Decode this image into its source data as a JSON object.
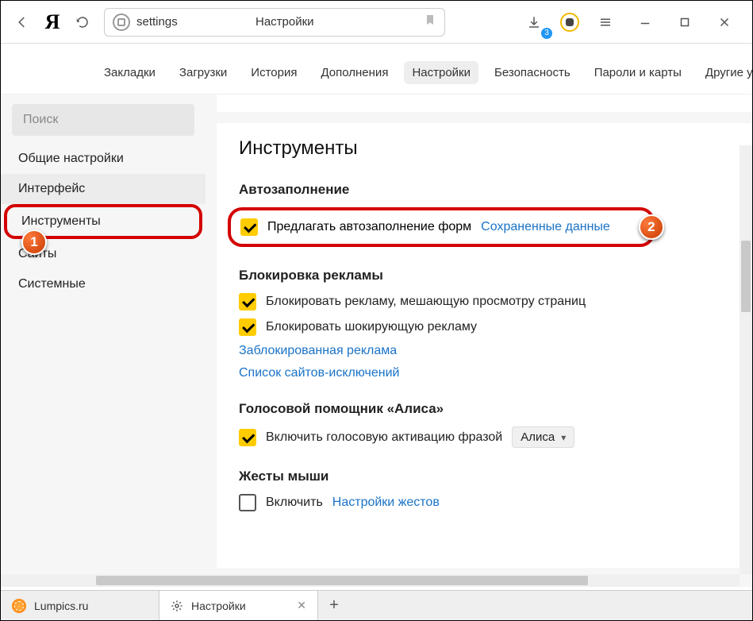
{
  "toolbar": {
    "address_slug": "settings",
    "address_title": "Настройки",
    "download_badge": "3"
  },
  "toptabs": {
    "items": [
      {
        "label": "Закладки"
      },
      {
        "label": "Загрузки"
      },
      {
        "label": "История"
      },
      {
        "label": "Дополнения"
      },
      {
        "label": "Настройки",
        "active": true
      },
      {
        "label": "Безопасность"
      },
      {
        "label": "Пароли и карты"
      },
      {
        "label": "Другие устройства"
      }
    ]
  },
  "sidebar": {
    "search_placeholder": "Поиск",
    "items": [
      {
        "label": "Общие настройки"
      },
      {
        "label": "Интерфейс"
      },
      {
        "label": "Инструменты"
      },
      {
        "label": "Сайты"
      },
      {
        "label": "Системные"
      }
    ]
  },
  "callouts": {
    "one": "1",
    "two": "2"
  },
  "content": {
    "title": "Инструменты",
    "autofill": {
      "heading": "Автозаполнение",
      "cb_label": "Предлагать автозаполнение форм",
      "link": "Сохраненные данные"
    },
    "adblock": {
      "heading": "Блокировка рекламы",
      "cb1": "Блокировать рекламу, мешающую просмотру страниц",
      "cb2": "Блокировать шокирующую рекламу",
      "link1": "Заблокированная реклама",
      "link2": "Список сайтов-исключений"
    },
    "alice": {
      "heading": "Голосовой помощник «Алиса»",
      "cb": "Включить голосовую активацию фразой",
      "select": "Алиса"
    },
    "mouse": {
      "heading": "Жесты мыши",
      "cb": "Включить",
      "link": "Настройки жестов"
    }
  },
  "btabs": {
    "items": [
      {
        "label": "Lumpics.ru"
      },
      {
        "label": "Настройки"
      }
    ]
  }
}
